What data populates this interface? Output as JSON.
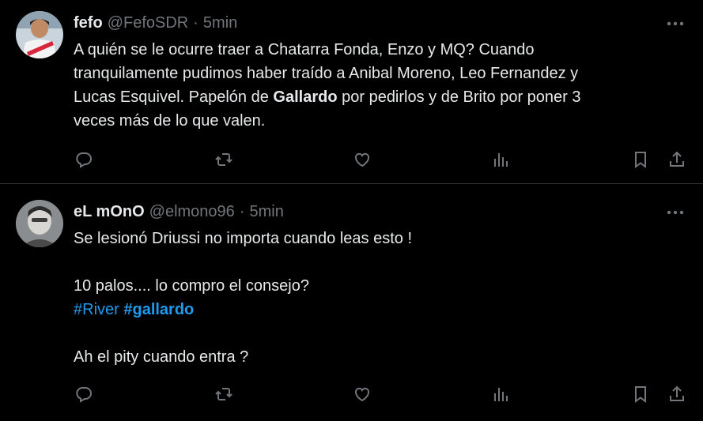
{
  "colors": {
    "background": "#000000",
    "text": "#e7e9ea",
    "secondary": "#71767b",
    "link": "#1d9bf0",
    "divider": "#2f3336"
  },
  "tweets": [
    {
      "name": "fefo",
      "handle": "@FefoSDR",
      "dot": "·",
      "time": "5min",
      "lines": [
        {
          "parts": [
            {
              "text": "A quién se le ocurre traer a Chatarra Fonda, Enzo y MQ? Cuando"
            }
          ]
        },
        {
          "parts": [
            {
              "text": "tranquilamente pudimos haber traído a Anibal Moreno, Leo Fernandez y"
            }
          ]
        },
        {
          "parts": [
            {
              "text": "Lucas Esquivel. Papelón de "
            },
            {
              "text": "Gallardo"
            },
            {
              "text": " por pedirlos y de Brito por poner 3"
            }
          ]
        },
        {
          "parts": [
            {
              "text": "veces más de lo que valen."
            }
          ]
        }
      ],
      "icons": {
        "more": "more-icon",
        "reply": "reply-icon",
        "retweet": "retweet-icon",
        "like": "like-icon",
        "views": "views-icon",
        "bookmark": "bookmark-icon",
        "share": "share-icon"
      }
    },
    {
      "name": "eL mOnO",
      "handle": "@elmono96",
      "dot": "·",
      "time": "5min",
      "lines": [
        {
          "parts": [
            {
              "text": "Se lesionó Driussi  no importa cuando leas esto !"
            }
          ]
        },
        {
          "parts": [
            {
              "text": "10 palos.... lo compro el consejo?"
            }
          ]
        },
        {
          "parts": [
            {
              "text": "#River"
            },
            {
              "text": " "
            },
            {
              "text": "#gallardo"
            }
          ]
        },
        {
          "parts": [
            {
              "text": "Ah el pity cuando entra ?"
            }
          ]
        }
      ],
      "icons": {
        "more": "more-icon",
        "reply": "reply-icon",
        "retweet": "retweet-icon",
        "like": "like-icon",
        "views": "views-icon",
        "bookmark": "bookmark-icon",
        "share": "share-icon"
      }
    }
  ]
}
